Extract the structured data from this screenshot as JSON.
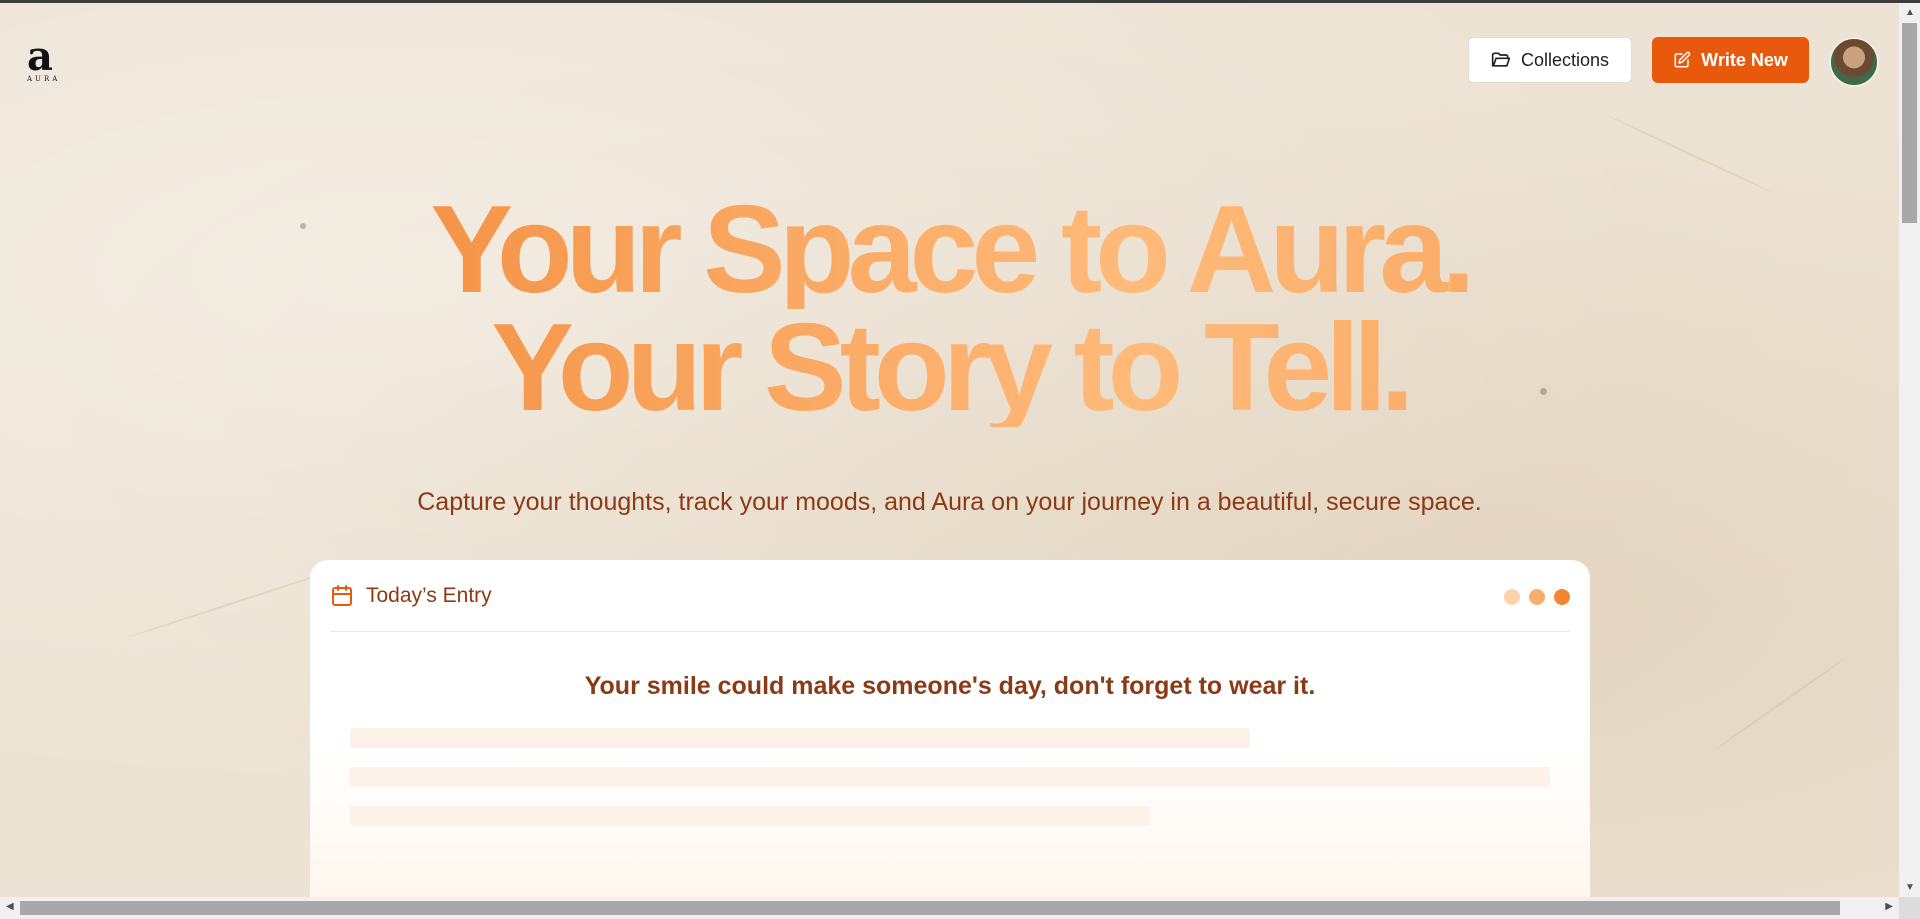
{
  "header": {
    "logo_glyph": "a",
    "logo_word": "AURA",
    "collections_label": "Collections",
    "write_new_label": "Write New"
  },
  "hero": {
    "line1": "Your Space to Aura.",
    "line2": "Your Story to Tell.",
    "subtitle": "Capture your thoughts, track your moods, and Aura on your journey in a beautiful, secure space."
  },
  "entry_card": {
    "title": "Today’s Entry",
    "quote": "Your smile could make someone's day, don't forget to wear it.",
    "dot_colors": [
      "#fcd3ad",
      "#f9ae6c",
      "#f4862f"
    ]
  },
  "colors": {
    "accent": "#e8590c",
    "text_brown": "#8b3a16",
    "background": "#ede3d4"
  }
}
